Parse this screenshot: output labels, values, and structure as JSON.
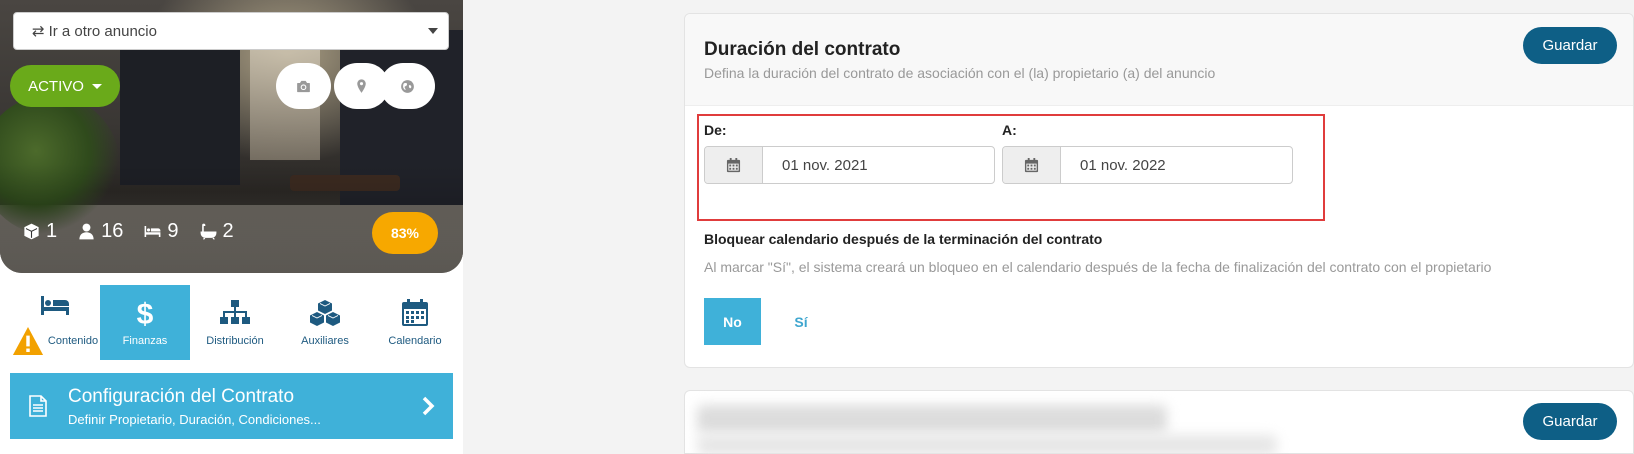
{
  "listing_select": {
    "label": "Ir a otro anuncio",
    "icon": "swap-icon"
  },
  "status": {
    "label": "ACTIVO",
    "color": "#6aaa1a"
  },
  "hero_actions": [
    {
      "icon": "camera-icon"
    },
    {
      "icon": "map-pin-icon"
    },
    {
      "icon": "globe-icon"
    }
  ],
  "stats": [
    {
      "icon": "cube-icon",
      "value": "1"
    },
    {
      "icon": "person-icon",
      "value": "16"
    },
    {
      "icon": "bed-icon",
      "value": "9"
    },
    {
      "icon": "bath-icon",
      "value": "2"
    }
  ],
  "completion": {
    "value": "83%",
    "color": "#f7a800"
  },
  "tabs": [
    {
      "label": "Contenido",
      "icon": "bed-icon",
      "warning": true,
      "active": false
    },
    {
      "label": "Finanzas",
      "icon": "dollar-icon",
      "active": true
    },
    {
      "label": "Distribución",
      "icon": "hierarchy-icon",
      "active": false
    },
    {
      "label": "Auxiliares",
      "icon": "boxes-icon",
      "active": false
    },
    {
      "label": "Calendario",
      "icon": "calendar-icon",
      "active": false
    }
  ],
  "contract_nav": {
    "title": "Configuración del Contrato",
    "subtitle": "Definir Propietario, Duración, Condiciones...",
    "icon": "document-icon"
  },
  "duration_card": {
    "title": "Duración del contrato",
    "description": "Defina la duración del contrato de asociación con el (la) propietario (a) del anuncio",
    "save_label": "Guardar",
    "from": {
      "label": "De:",
      "value": "01 nov. 2021"
    },
    "to": {
      "label": "A:",
      "value": "01 nov. 2022"
    },
    "block_title": "Bloquear calendario después de la terminación del contrato",
    "block_description": "Al marcar \"Sí\", el sistema creará un bloqueo en el calendario después de la fecha de finalización del contrato con el propietario",
    "no_label": "No",
    "yes_label": "Sí"
  },
  "second_card": {
    "save_label": "Guardar"
  },
  "colors": {
    "accent": "#3fb1d9",
    "primary": "#0e5f86",
    "highlight": "#e03c3c"
  }
}
